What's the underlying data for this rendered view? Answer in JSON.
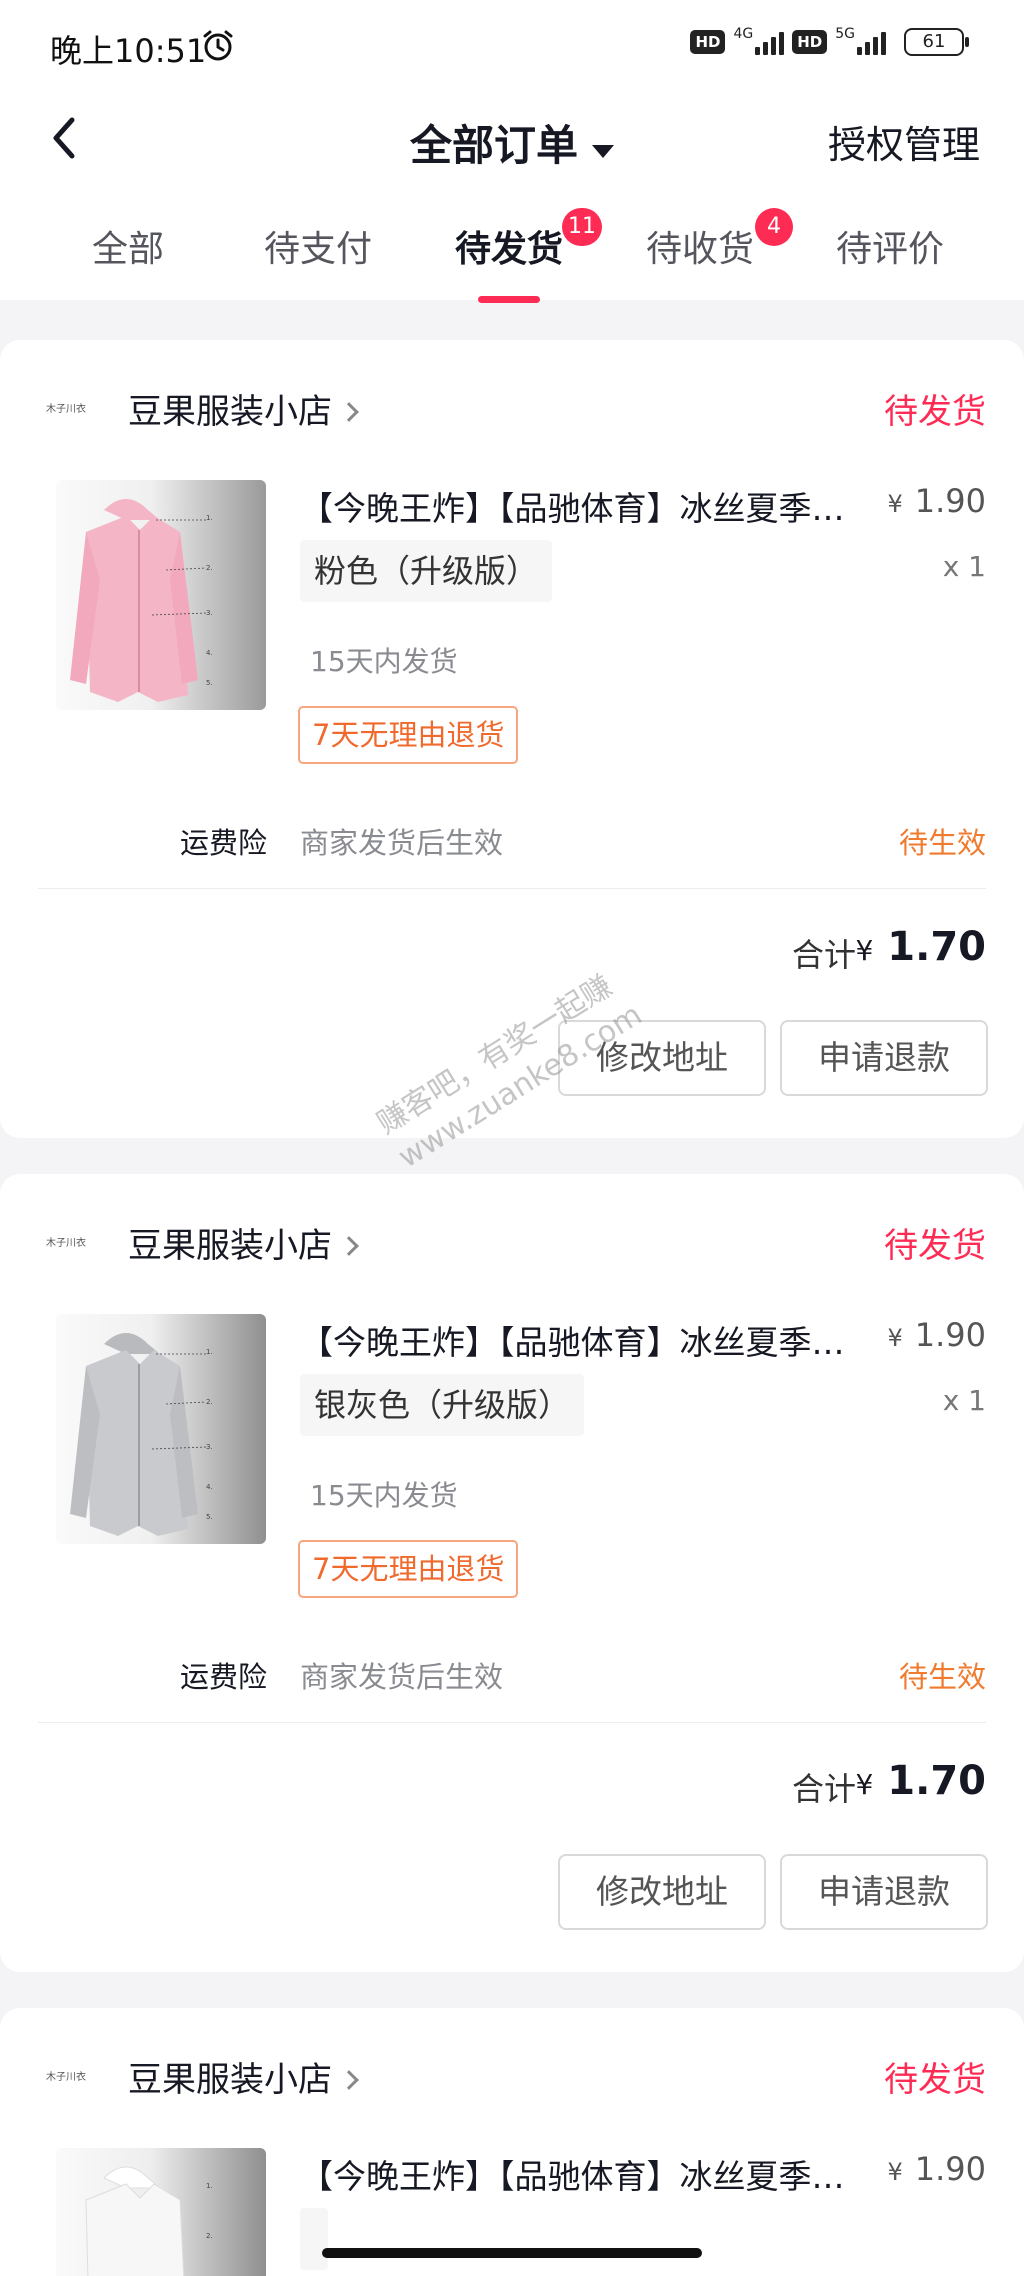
{
  "status_bar": {
    "time": "晚上10:51",
    "hd1": "HD",
    "net1": "4G",
    "hd2": "HD",
    "net2": "5G",
    "battery": "61"
  },
  "nav": {
    "title": "全部订单",
    "right_link": "授权管理"
  },
  "tabs": [
    {
      "label": "全部",
      "badge": null
    },
    {
      "label": "待支付",
      "badge": null
    },
    {
      "label": "待发货",
      "badge": "11"
    },
    {
      "label": "待收货",
      "badge": "4"
    },
    {
      "label": "待评价",
      "badge": null
    }
  ],
  "orders": [
    {
      "shop_logo_text": "木子川衣",
      "shop_name": "豆果服装小店",
      "status": "待发货",
      "title": "【今晚王炸】【品驰体育】冰丝夏季防晒衣",
      "price_symbol": "¥",
      "price": "1.90",
      "sku": "粉色（升级版）",
      "qty": "x 1",
      "ship_time": "15天内发货",
      "return_tag": "7天无理由退货",
      "insurance_label": "运费险",
      "insurance_desc": "商家发货后生效",
      "insurance_status": "待生效",
      "total_label": "合计",
      "total_symbol": "¥",
      "total": "1.70",
      "btn_address": "修改地址",
      "btn_refund": "申请退款",
      "color": "#f4b6c6"
    },
    {
      "shop_logo_text": "木子川衣",
      "shop_name": "豆果服装小店",
      "status": "待发货",
      "title": "【今晚王炸】【品驰体育】冰丝夏季防晒衣",
      "price_symbol": "¥",
      "price": "1.90",
      "sku": "银灰色（升级版）",
      "qty": "x 1",
      "ship_time": "15天内发货",
      "return_tag": "7天无理由退货",
      "insurance_label": "运费险",
      "insurance_desc": "商家发货后生效",
      "insurance_status": "待生效",
      "total_label": "合计",
      "total_symbol": "¥",
      "total": "1.70",
      "btn_address": "修改地址",
      "btn_refund": "申请退款",
      "color": "#c9cacd"
    },
    {
      "shop_logo_text": "木子川衣",
      "shop_name": "豆果服装小店",
      "status": "待发货",
      "title": "【今晚王炸】【品驰体育】冰丝夏季防晒衣",
      "price_symbol": "¥",
      "price": "1.90",
      "sku": "",
      "qty": "",
      "color": "#f2f2f2"
    }
  ],
  "watermark": {
    "line1": "赚客吧，有奖一起赚",
    "line2": "www.zuanke8.com"
  }
}
